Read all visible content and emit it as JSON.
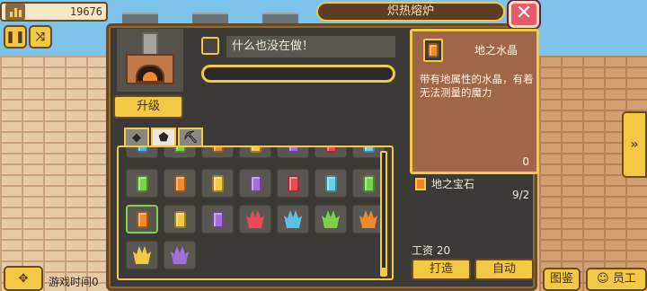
{
  "hud": {
    "gold": "19676",
    "pause_icon": "pause-icon",
    "speed_icon": "shuffle-icon",
    "game_time_label": "游戏时间0"
  },
  "dialog": {
    "title": "炽热熔炉",
    "close_label": "✕",
    "status_text": "什么也没在做！",
    "upgrade_label": "升级",
    "progress": 0,
    "tabs": [
      {
        "icon": "tag-icon",
        "glyph": "◆"
      },
      {
        "icon": "gem-icon",
        "glyph": "⬟"
      },
      {
        "icon": "pickaxe-icon",
        "glyph": "⛏"
      }
    ]
  },
  "info": {
    "item_name": "地之水晶",
    "description": "带有地属性的水晶，有着无法测量的魔力",
    "owned_count": "0",
    "requirement_name": "地之宝石",
    "requirement_count": "9/2",
    "wage": "工资 20",
    "craft_label": "打造",
    "auto_label": "自动"
  },
  "bottom": {
    "encyclopedia_label": "图鉴",
    "staff_label": "员工",
    "staff_icon": "people-icon"
  },
  "inventory": {
    "top_row_partial": [
      "#5ab0e0",
      "#7ed04a",
      "#f08a2a",
      "#f2c844",
      "#a070d8",
      "#e84a5a",
      "#6ad0e8"
    ],
    "rows": [
      [
        {
          "kind": "crystal",
          "color": "#7ed04a"
        },
        {
          "kind": "crystal",
          "color": "#f08a2a"
        },
        {
          "kind": "crystal",
          "color": "#f2c844"
        },
        {
          "kind": "crystal",
          "color": "#a070d8"
        },
        {
          "kind": "crystal",
          "color": "#e84a5a"
        },
        {
          "kind": "crystal",
          "color": "#6ad0e8"
        },
        {
          "kind": "crystal",
          "color": "#7ed04a"
        }
      ],
      [
        {
          "kind": "crystal",
          "color": "#f08a2a",
          "selected": true
        },
        {
          "kind": "crystal",
          "color": "#f2c844"
        },
        {
          "kind": "crystal",
          "color": "#a070d8"
        },
        {
          "kind": "stone",
          "color": "#e84a5a"
        },
        {
          "kind": "stone",
          "color": "#5ac0e0"
        },
        {
          "kind": "stone",
          "color": "#7ed04a"
        },
        {
          "kind": "stone",
          "color": "#f08a2a"
        }
      ],
      [
        {
          "kind": "stone",
          "color": "#f2c844"
        },
        {
          "kind": "stone",
          "color": "#a070d8"
        }
      ]
    ]
  }
}
